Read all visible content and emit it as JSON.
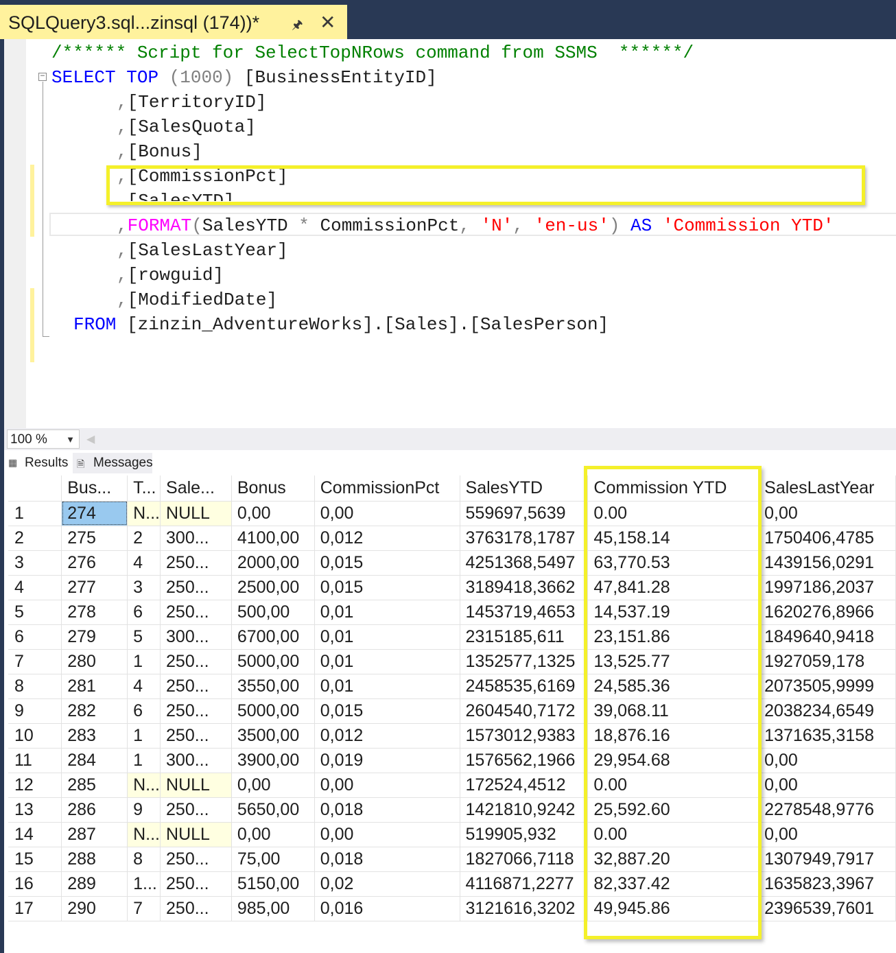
{
  "tab": {
    "title": "SQLQuery3.sql...zinsql (174))*",
    "pin_icon": "pin-icon",
    "close_icon": "close-icon"
  },
  "editor": {
    "comment": "/****** Script for SelectTopNRows command from SSMS  ******/",
    "select_kw": "SELECT",
    "top_kw": "TOP",
    "top_value": "(1000)",
    "first_col": "[BusinessEntityID]",
    "columns": [
      "[TerritoryID]",
      "[SalesQuota]",
      "[Bonus]",
      "[CommissionPct]",
      "[SalesYTD]"
    ],
    "format_fn": "FORMAT",
    "format_args": "SalesYTD",
    "format_star": "*",
    "format_arg2": "CommissionPct",
    "format_str1": "'N'",
    "format_str2": "'en-us'",
    "as_kw": "AS",
    "alias": "'Commission YTD'",
    "columns_after": [
      "[SalesLastYear]",
      "[rowguid]",
      "[ModifiedDate]"
    ],
    "from_kw": "FROM",
    "from_table": "[zinzin_AdventureWorks].[Sales].[SalesPerson]"
  },
  "zoom": {
    "value": "100 %"
  },
  "result_tabs": {
    "results": "Results",
    "messages": "Messages"
  },
  "grid": {
    "headers": [
      "",
      "Bus...",
      "T...",
      "Sale...",
      "Bonus",
      "CommissionPct",
      "SalesYTD",
      "Commission YTD",
      "SalesLastYear"
    ],
    "rows": [
      [
        "1",
        "274",
        "N...",
        "NULL",
        "0,00",
        "0,00",
        "559697,5639",
        "0.00",
        "0,00"
      ],
      [
        "2",
        "275",
        "2",
        "300...",
        "4100,00",
        "0,012",
        "3763178,1787",
        "45,158.14",
        "1750406,4785"
      ],
      [
        "3",
        "276",
        "4",
        "250...",
        "2000,00",
        "0,015",
        "4251368,5497",
        "63,770.53",
        "1439156,0291"
      ],
      [
        "4",
        "277",
        "3",
        "250...",
        "2500,00",
        "0,015",
        "3189418,3662",
        "47,841.28",
        "1997186,2037"
      ],
      [
        "5",
        "278",
        "6",
        "250...",
        "500,00",
        "0,01",
        "1453719,4653",
        "14,537.19",
        "1620276,8966"
      ],
      [
        "6",
        "279",
        "5",
        "300...",
        "6700,00",
        "0,01",
        "2315185,611",
        "23,151.86",
        "1849640,9418"
      ],
      [
        "7",
        "280",
        "1",
        "250...",
        "5000,00",
        "0,01",
        "1352577,1325",
        "13,525.77",
        "1927059,178"
      ],
      [
        "8",
        "281",
        "4",
        "250...",
        "3550,00",
        "0,01",
        "2458535,6169",
        "24,585.36",
        "2073505,9999"
      ],
      [
        "9",
        "282",
        "6",
        "250...",
        "5000,00",
        "0,015",
        "2604540,7172",
        "39,068.11",
        "2038234,6549"
      ],
      [
        "10",
        "283",
        "1",
        "250...",
        "3500,00",
        "0,012",
        "1573012,9383",
        "18,876.16",
        "1371635,3158"
      ],
      [
        "11",
        "284",
        "1",
        "300...",
        "3900,00",
        "0,019",
        "1576562,1966",
        "29,954.68",
        "0,00"
      ],
      [
        "12",
        "285",
        "N...",
        "NULL",
        "0,00",
        "0,00",
        "172524,4512",
        "0.00",
        "0,00"
      ],
      [
        "13",
        "286",
        "9",
        "250...",
        "5650,00",
        "0,018",
        "1421810,9242",
        "25,592.60",
        "2278548,9776"
      ],
      [
        "14",
        "287",
        "N...",
        "NULL",
        "0,00",
        "0,00",
        "519905,932",
        "0.00",
        "0,00"
      ],
      [
        "15",
        "288",
        "8",
        "250...",
        "75,00",
        "0,018",
        "1827066,7118",
        "32,887.20",
        "1307949,7917"
      ],
      [
        "16",
        "289",
        "1...",
        "250...",
        "5150,00",
        "0,02",
        "4116871,2277",
        "82,337.42",
        "1635823,3967"
      ],
      [
        "17",
        "290",
        "7",
        "250...",
        "985,00",
        "0,016",
        "3121616,3202",
        "49,945.86",
        "2396539,7601"
      ]
    ]
  },
  "colors": {
    "highlight": "#f4f02a",
    "tab_bg": "#fff29d",
    "chrome": "#293955",
    "null_cell": "#ffffe1",
    "selected_cell": "#99c9ef"
  }
}
